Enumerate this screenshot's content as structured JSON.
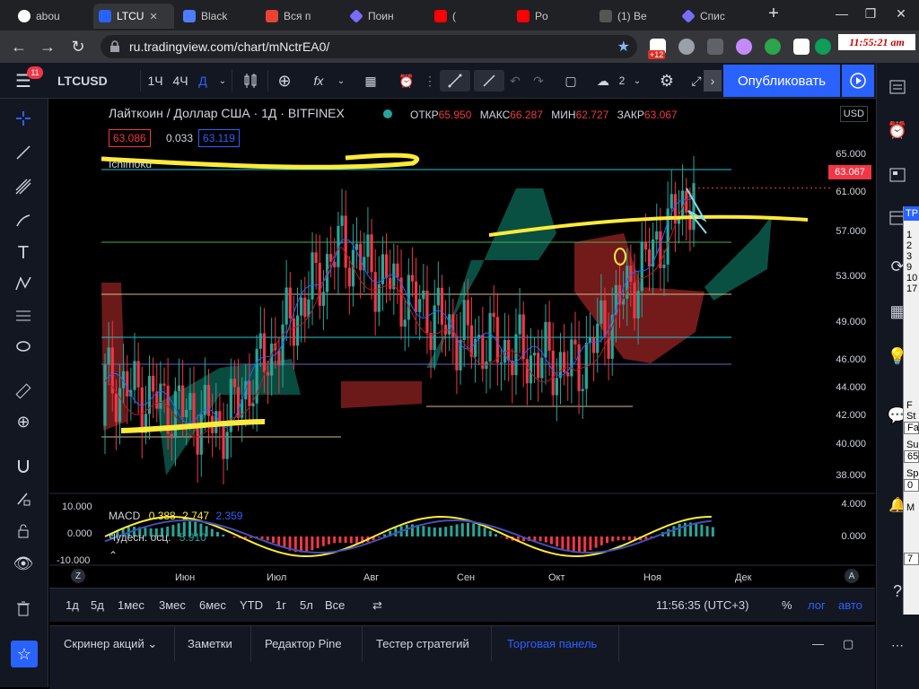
{
  "browser": {
    "tabs": [
      {
        "title": "abou",
        "icon": "github-icon",
        "color": "#ffffff"
      },
      {
        "title": "LTCU",
        "icon": "tradingview-icon",
        "color": "#2962ff",
        "active": true
      },
      {
        "title": "Black",
        "icon": "document-icon",
        "color": "#4f7cff"
      },
      {
        "title": "Вся п",
        "icon": "gmail-icon",
        "color": "#ea4335"
      },
      {
        "title": "Поин",
        "icon": "diamond-icon",
        "color": "#7b6cff"
      },
      {
        "title": "(",
        "icon": "youtube-icon",
        "color": "#ff0000"
      },
      {
        "title": "Po",
        "icon": "youtube-icon",
        "color": "#ff0000"
      },
      {
        "title": "(1) Be",
        "icon": "dots-icon",
        "color": "#aaaaaa"
      },
      {
        "title": "Спис",
        "icon": "diamond-icon",
        "color": "#7b6cff"
      }
    ],
    "new_tab": "+",
    "url": "ru.tradingview.com/chart/mNctrEA0/",
    "ext_badge": "+12",
    "clock_ext": "11:55:21 am"
  },
  "toolbar": {
    "symbol": "LTCUSD",
    "intervals": [
      "1Ч",
      "4Ч",
      "Д"
    ],
    "active_interval": "Д",
    "layout_count": "2",
    "publish_label": "Опубликовать",
    "notification_count": "11"
  },
  "chart": {
    "title": "Лайткоин / Доллар США · 1Д · BITFINEX",
    "ohlc": {
      "open_label": "ОТКР",
      "open": "65.950",
      "high_label": "МАКС",
      "high": "66.287",
      "low_label": "МИН",
      "low": "62.727",
      "close_label": "ЗАКР",
      "close": "63.067"
    },
    "bid": "63.086",
    "spread": "0.033",
    "ask": "63.119",
    "currency": "USD",
    "current_price": "63.067",
    "ichimoku_label": "Ichimoku",
    "macd_label": "MACD",
    "macd_values": [
      "0.388",
      "2.747",
      "2.359"
    ],
    "ao_label": "Чудесн. осц.",
    "ao_value": "5.910",
    "price_axis": [
      "65.000",
      "61.000",
      "57.000",
      "53.000",
      "49.000",
      "46.000",
      "44.000",
      "42.000",
      "40.000",
      "38.000"
    ],
    "indicator_axis": [
      "4.000",
      "0.000"
    ],
    "indicator_axis_left": [
      "10.000",
      "0.000",
      "-10.000"
    ],
    "time_axis": [
      "Июн",
      "Июл",
      "Авг",
      "Сен",
      "Окт",
      "Ноя",
      "Дек"
    ],
    "colors": {
      "up": "#26a69a",
      "down": "#f23645",
      "highlight": "#ffeb3b",
      "accent": "#2962ff"
    }
  },
  "chart_data": {
    "type": "candlestick",
    "title": "Лайткоин / Доллар США · 1Д · BITFINEX",
    "categories": [
      "Июн",
      "Июл",
      "Авг",
      "Сен",
      "Окт",
      "Ноя"
    ],
    "values": [
      46,
      42,
      58,
      50,
      47,
      63
    ],
    "ylim": [
      36,
      67
    ]
  },
  "range_bar": {
    "ranges": [
      "1д",
      "5д",
      "1мес",
      "3мес",
      "6мес",
      "YTD",
      "1г",
      "5л",
      "Все"
    ],
    "time": "11:56:35 (UTC+3)",
    "percent": "%",
    "log": "лог",
    "auto": "авто"
  },
  "bottom_tabs": [
    "Скринер акций",
    "Заметки",
    "Редактор Pine",
    "Тестер стратегий",
    "Торговая панель"
  ],
  "popup": {
    "lines": [
      "TP",
      "1",
      "2",
      "3",
      "9",
      "10",
      "17",
      "F",
      "St",
      "Fa",
      "Su",
      "65",
      "Sp",
      "0",
      "M",
      "7"
    ]
  }
}
